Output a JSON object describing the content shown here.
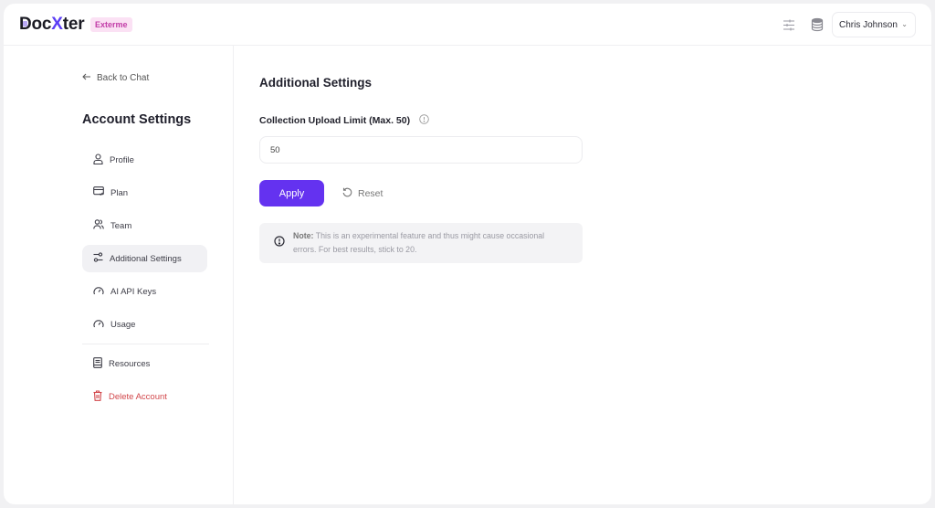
{
  "header": {
    "brand_prefix": "Doc",
    "brand_x": "X",
    "brand_suffix": "ter",
    "plan_badge": "Exterme",
    "icons": [
      "sliders-icon",
      "coins-icon"
    ],
    "user_name": "Chris Johnson"
  },
  "sidebar": {
    "back_label": "Back to Chat",
    "title": "Account Settings",
    "items": [
      {
        "label": "Profile",
        "icon": "user-icon"
      },
      {
        "label": "Plan",
        "icon": "card-icon"
      },
      {
        "label": "Team",
        "icon": "team-icon"
      },
      {
        "label": "Additional Settings",
        "icon": "sliders-icon",
        "active": true
      },
      {
        "label": "AI API Keys",
        "icon": "gauge-icon"
      },
      {
        "label": "Usage",
        "icon": "gauge-icon"
      }
    ],
    "secondary_items": [
      {
        "label": "Resources",
        "icon": "book-icon"
      },
      {
        "label": "Delete Account",
        "icon": "trash-icon",
        "danger": true
      }
    ]
  },
  "main": {
    "title": "Additional Settings",
    "field_label": "Collection Upload Limit (Max. 50)",
    "field_value": "50",
    "apply_label": "Apply",
    "reset_label": "Reset",
    "note_label": "Note:",
    "note_text": " This is an experimental feature and thus might cause occasional errors. For best results, stick to 20."
  },
  "colors": {
    "accent": "#6432f0",
    "danger": "#d2474b",
    "badge_bg": "#fbe1f4",
    "badge_text": "#c23ca7"
  }
}
